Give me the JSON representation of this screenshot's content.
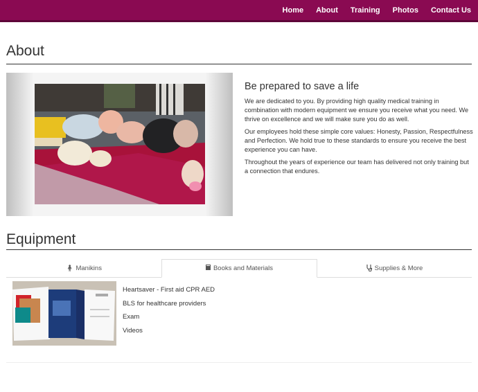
{
  "nav": {
    "links": [
      "Home",
      "About",
      "Training",
      "Photos",
      "Contact Us"
    ]
  },
  "about": {
    "title": "About",
    "heading": "Be prepared to save a life",
    "paragraphs": [
      "We are dedicated to you. By providing high quality medical training in combination with modern equipment we ensure you receive what you need. We thrive on excellence and we will make sure you do as well.",
      "Our employees hold these simple core values: Honesty, Passion, Respectfulness and Perfection. We hold true to these standards to ensure you receive the best experience you can have.",
      "Throughout the years of experience our team has delivered not only training but a connection that endures."
    ]
  },
  "equipment": {
    "title": "Equipment",
    "tabs": [
      {
        "label": "Manikins",
        "icon": "person-icon",
        "active": false
      },
      {
        "label": "Books and Materials",
        "icon": "book-icon",
        "active": true
      },
      {
        "label": "Supplies & More",
        "icon": "stethoscope-icon",
        "active": false
      }
    ],
    "items": [
      "Heartsaver - First aid CPR AED",
      "BLS for healthcare providers",
      "Exam",
      "Videos"
    ]
  },
  "colors": {
    "navbar": "#8a0a52",
    "navbar_border": "#5e0638"
  }
}
